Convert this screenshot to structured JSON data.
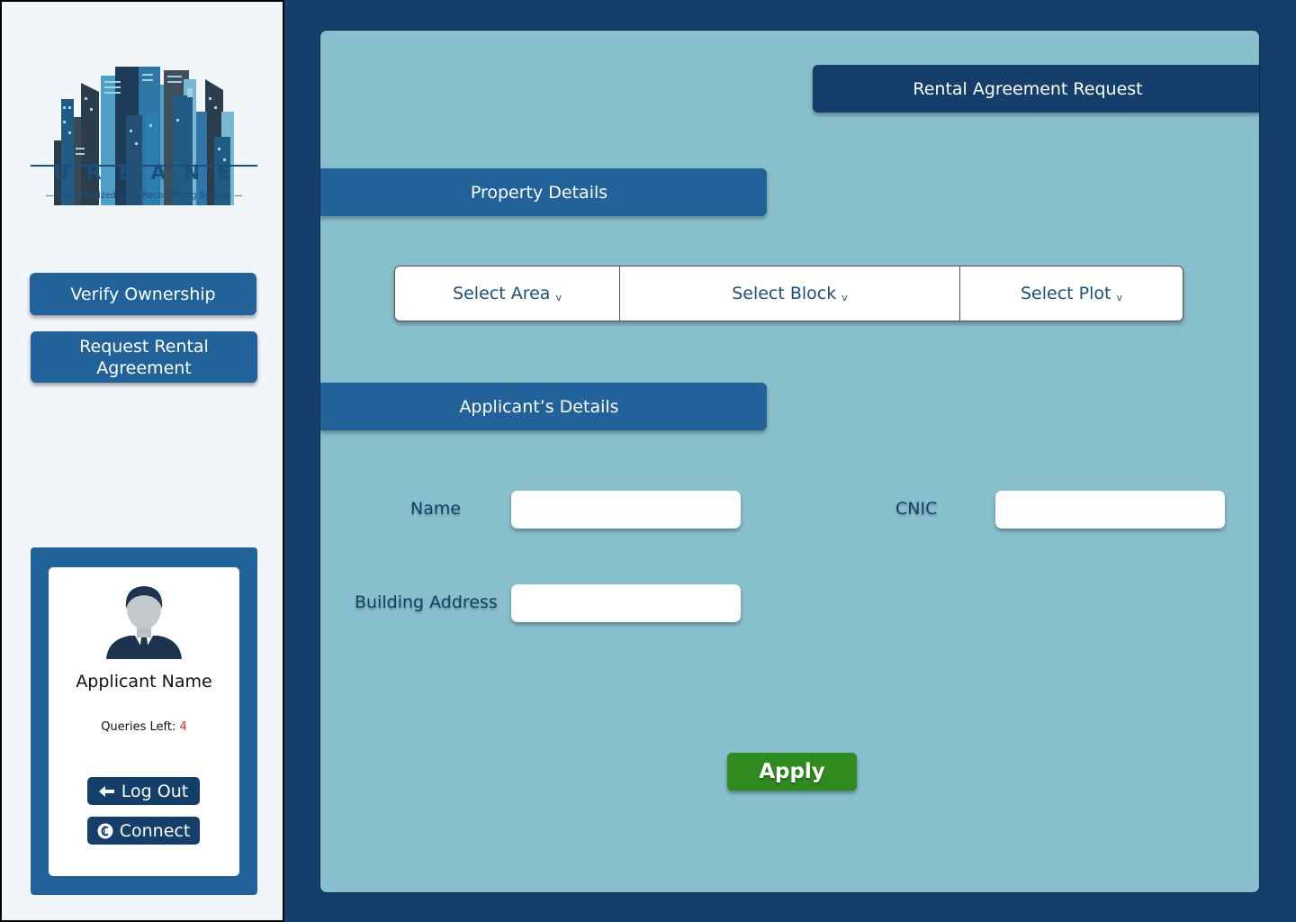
{
  "brand": {
    "name": "URBANE",
    "tagline": "— Decentralized Land Record Filing System —"
  },
  "sidebar": {
    "nav": [
      {
        "label": "Verify Ownership"
      },
      {
        "label": "Request Rental Agreement"
      }
    ],
    "profile": {
      "name": "Applicant Name",
      "queries_label": "Queries Left:",
      "queries_count": "4",
      "logout_label": "Log Out",
      "connect_label": "Connect",
      "logout_icon": "arrow-left-icon",
      "connect_icon": "coin-icon"
    }
  },
  "main": {
    "title": "Rental Agreement Request",
    "property_header": "Property Details",
    "applicant_header": "Applicant’s Details",
    "selects": [
      {
        "label": "Select Area",
        "caret": "v"
      },
      {
        "label": "Select Block",
        "caret": "v"
      },
      {
        "label": "Select Plot",
        "caret": "v"
      }
    ],
    "fields": {
      "name_label": "Name",
      "name_value": "",
      "cnic_label": "CNIC",
      "cnic_value": "",
      "address_label": "Building Address",
      "address_value": ""
    },
    "apply_label": "Apply"
  },
  "colors": {
    "navy": "#143f6a",
    "blue": "#22629b",
    "panel": "#88bfcc",
    "apply_green": "#2e8b1d",
    "queries_red": "#e2262b"
  }
}
